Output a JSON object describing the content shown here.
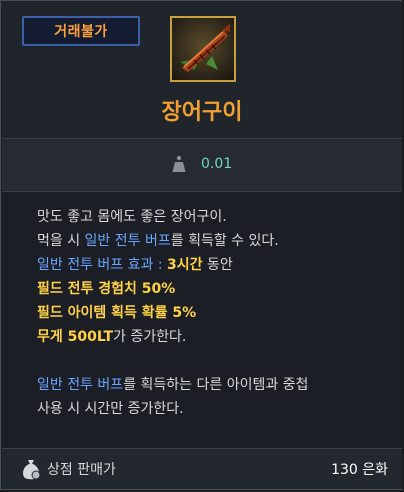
{
  "badge": {
    "label": "거래불가"
  },
  "item": {
    "icon": "grilled-eel-icon",
    "name": "장어구이"
  },
  "weight": {
    "icon": "weight-icon",
    "value": "0.01"
  },
  "description": {
    "line1": "맛도 좋고 몸에도 좋은 장어구이.",
    "line2_pre": "먹을 시 ",
    "line2_link": "일반 전투 버프",
    "line2_post": "를 획득할 수 있다.",
    "line3_pre": "일반 전투 버프 효과 : ",
    "line3_duration": "3시간",
    "line3_post": " 동안",
    "line4": "필드 전투 경험치 50%",
    "line5": "필드 아이템 획득 확률 5%",
    "line6_weight": "무게 500LT",
    "line6_post": "가 증가한다.",
    "line7_link": "일반 전투 버프",
    "line7_post": "를 획득하는 다른 아이템과 중첩",
    "line8": "사용 시 시간만 증가한다."
  },
  "footer": {
    "icon": "money-bag-icon",
    "label": "상점 판매가",
    "price": "130 은화"
  },
  "colors": {
    "badge_text": "#ffa03a",
    "item_name": "#f0a030",
    "weight_value": "#6fd6c4",
    "link_blue": "#6aa6ff",
    "highlight_gold": "#ffd24a"
  }
}
